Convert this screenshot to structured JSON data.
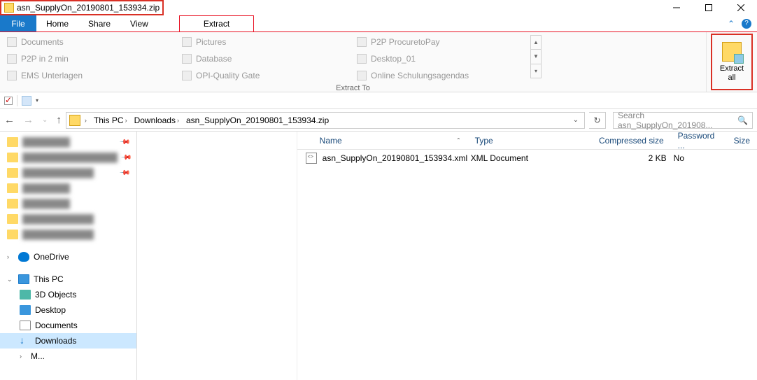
{
  "titlebar": {
    "filename": "asn_SupplyOn_20190801_153934.zip"
  },
  "tabs": {
    "file": "File",
    "home": "Home",
    "share": "Share",
    "view": "View",
    "extract": "Extract"
  },
  "ribbon": {
    "destinations": {
      "col1": [
        "Documents",
        "P2P in 2 min",
        "EMS Unterlagen"
      ],
      "col2": [
        "Pictures",
        "Database",
        "OPI-Quality Gate"
      ],
      "col3": [
        "P2P ProcuretoPay",
        "Desktop_01",
        "Online Schulungsagendas"
      ]
    },
    "extract_to_label": "Extract To",
    "extract_all_line1": "Extract",
    "extract_all_line2": "all"
  },
  "breadcrumb": {
    "segments": [
      "This PC",
      "Downloads",
      "asn_SupplyOn_20190801_153934.zip"
    ]
  },
  "search": {
    "placeholder": "Search asn_SupplyOn_201908..."
  },
  "sidebar": {
    "onedrive": "OneDrive",
    "thispc": "This PC",
    "obj3d": "3D Objects",
    "desktop": "Desktop",
    "documents": "Documents",
    "downloads": "Downloads"
  },
  "columns": {
    "name": "Name",
    "type": "Type",
    "compressed": "Compressed size",
    "password": "Password ...",
    "size": "Size"
  },
  "files": [
    {
      "name": "asn_SupplyOn_20190801_153934.xml",
      "type": "XML Document",
      "compressed_size": "2 KB",
      "password": "No"
    }
  ]
}
